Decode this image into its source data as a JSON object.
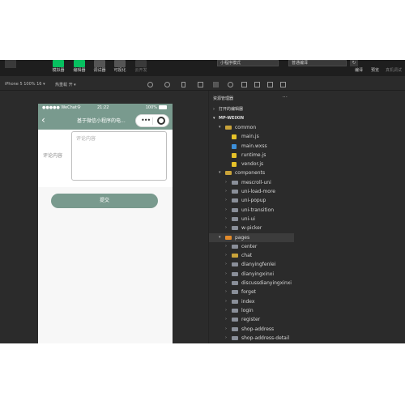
{
  "toolbar": {
    "tools": [
      {
        "label": "模拟器",
        "icon": "phone-icon",
        "active": true
      },
      {
        "label": "编辑器",
        "icon": "code-icon",
        "active": true
      },
      {
        "label": "调试器",
        "icon": "debug-icon",
        "active": false
      },
      {
        "label": "可视化",
        "icon": "visual-icon",
        "active": false
      },
      {
        "label": "云开发",
        "icon": "cloud-icon",
        "active": false
      }
    ],
    "mode": "小程序模式",
    "compile": "普通编译",
    "right_tools": [
      "编译",
      "预览",
      "真机调试"
    ]
  },
  "simulator_bar": {
    "device": "iPhone 5 100% 16 ▾",
    "hot_reload": "热重载 开 ▾"
  },
  "phone": {
    "carrier": "●●●●● WeChat令",
    "time": "21:22",
    "battery": "100%",
    "back": "‹",
    "title": "基于微信小程序的电...",
    "capsule_dots": "•••",
    "form_label": "评论内容",
    "textarea_placeholder": "评论内容",
    "submit": "提交"
  },
  "explorer": {
    "title": "资源管理器",
    "more": "···",
    "open_editors": "打开的编辑器",
    "project": "MP-WEIXIN",
    "tree": [
      {
        "name": "common",
        "depth": 1,
        "type": "folder-y",
        "arrow": "▾"
      },
      {
        "name": "main.js",
        "depth": 2,
        "type": "js",
        "arrow": ""
      },
      {
        "name": "main.wxss",
        "depth": 2,
        "type": "css",
        "arrow": ""
      },
      {
        "name": "runtime.js",
        "depth": 2,
        "type": "js",
        "arrow": ""
      },
      {
        "name": "vendor.js",
        "depth": 2,
        "type": "js",
        "arrow": ""
      },
      {
        "name": "components",
        "depth": 1,
        "type": "folder-y",
        "arrow": "▾"
      },
      {
        "name": "mescroll-uni",
        "depth": 2,
        "type": "folder",
        "arrow": "›"
      },
      {
        "name": "uni-load-more",
        "depth": 2,
        "type": "folder",
        "arrow": "›"
      },
      {
        "name": "uni-popup",
        "depth": 2,
        "type": "folder",
        "arrow": "›"
      },
      {
        "name": "uni-transition",
        "depth": 2,
        "type": "folder",
        "arrow": "›"
      },
      {
        "name": "uni-ui",
        "depth": 2,
        "type": "folder",
        "arrow": "›"
      },
      {
        "name": "w-picker",
        "depth": 2,
        "type": "folder",
        "arrow": "›"
      },
      {
        "name": "pages",
        "depth": 1,
        "type": "folder-o",
        "arrow": "▾",
        "selected": true
      },
      {
        "name": "center",
        "depth": 2,
        "type": "folder",
        "arrow": "›"
      },
      {
        "name": "chat",
        "depth": 2,
        "type": "folder-y",
        "arrow": "›"
      },
      {
        "name": "dianyingfenlei",
        "depth": 2,
        "type": "folder",
        "arrow": "›"
      },
      {
        "name": "dianyingxinxi",
        "depth": 2,
        "type": "folder",
        "arrow": "›"
      },
      {
        "name": "discussdianyingxinxi",
        "depth": 2,
        "type": "folder",
        "arrow": "›"
      },
      {
        "name": "forget",
        "depth": 2,
        "type": "folder",
        "arrow": "›"
      },
      {
        "name": "index",
        "depth": 2,
        "type": "folder",
        "arrow": "›"
      },
      {
        "name": "login",
        "depth": 2,
        "type": "folder",
        "arrow": "›"
      },
      {
        "name": "register",
        "depth": 2,
        "type": "folder",
        "arrow": "›"
      },
      {
        "name": "shop-address",
        "depth": 2,
        "type": "folder",
        "arrow": "›"
      },
      {
        "name": "shop-address-detail",
        "depth": 2,
        "type": "folder",
        "arrow": "›"
      }
    ]
  }
}
